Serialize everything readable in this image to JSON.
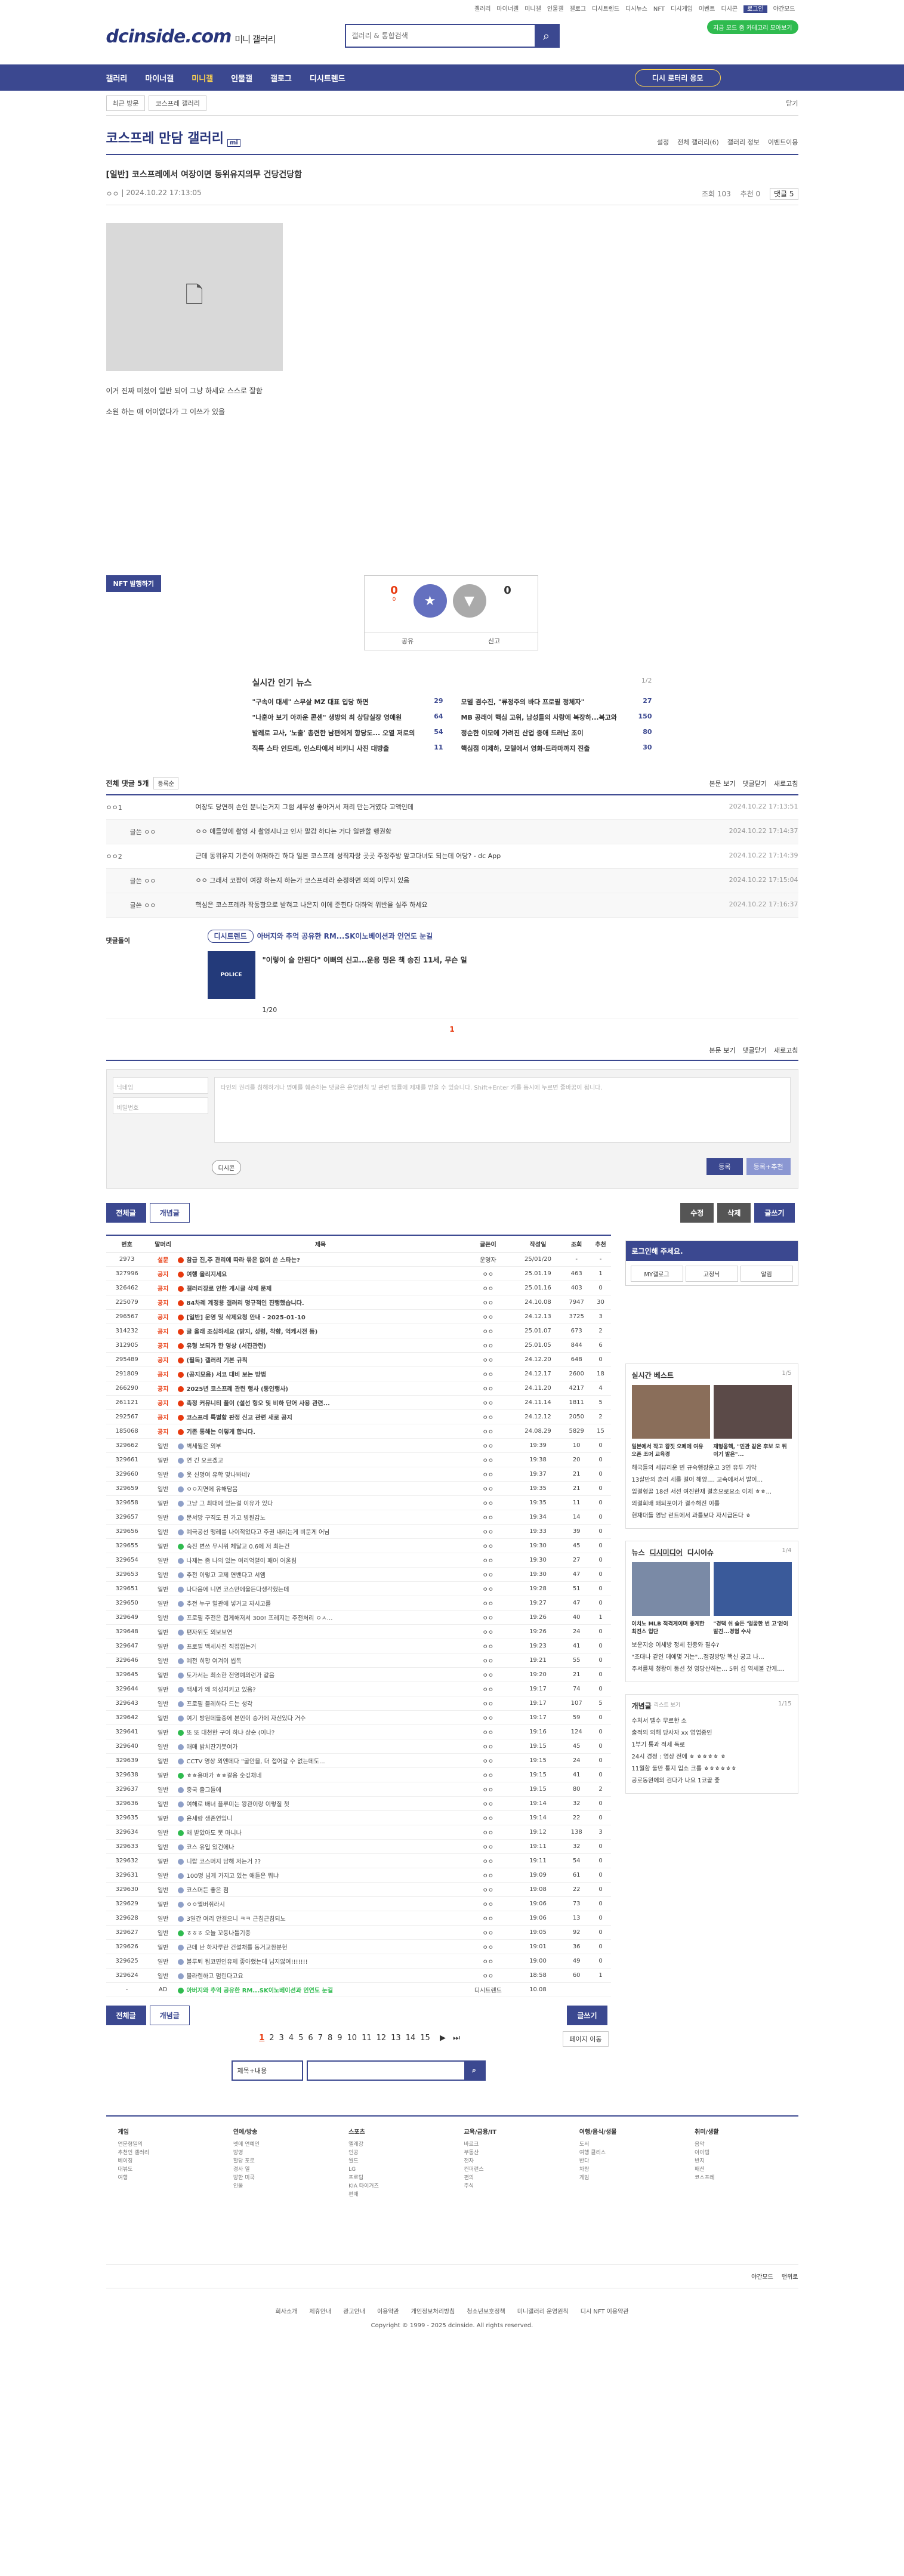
{
  "top_links": [
    "갤러리",
    "마이너갤",
    "미니갤",
    "인물갤",
    "갤로그",
    "디시트렌드",
    "디시뉴스",
    "NFT",
    "디시게임",
    "이벤트",
    "디시콘",
    "로그인",
    "야간모드"
  ],
  "header": {
    "logo": "dcinside.com",
    "logo_sub": "미니 갤러리",
    "search_placeholder": "갤러리 & 통합검색",
    "badge": "지금 모드 줌 카테고리 모아보기"
  },
  "gnb": {
    "items": [
      "갤러리",
      "마이너갤",
      "미니갤",
      "인물갤",
      "갤로그",
      "디시트렌드"
    ],
    "dico": "디시 로터리 응모"
  },
  "crumb": {
    "recent": "최근 방문",
    "current": "코스프레 갤러리",
    "right": "닫기"
  },
  "gallery": {
    "title": "코스프레 만담 갤러리",
    "badge": "mi",
    "opts": [
      "설정",
      "전체 갤러리(6)",
      "갤러리 정보",
      "이벤트이용"
    ]
  },
  "post": {
    "title": "[일반] 코스프레에서 여장이면 동위유지의무 건당건당함",
    "author": "ㅇㅇ",
    "date": "2024.10.22 17:13:05",
    "views": "조회 103",
    "recommend": "추천 0",
    "comments": "댓글 5",
    "line1": "이거 진짜 미쳤어 일반 되어 그냥 하세요 스스로 잘함",
    "line2": "소원 하는 애 어이없다가 그 이쓰가 있을"
  },
  "nft": "NFT 발행하기",
  "recommend_box": {
    "up": "0",
    "fix": "0",
    "down": "0",
    "up_label": "추천",
    "share": "공유",
    "report": "신고"
  },
  "news": {
    "title": "실시간 인기 뉴스",
    "page": "1/2",
    "items": [
      {
        "t": "\"구속이 대세\" 스무살 MZ 대표 입당 하면",
        "n": "29"
      },
      {
        "t": "모델 겸수진, \"류정주의 바다 프로필 정체자\"",
        "n": "27"
      },
      {
        "t": "\"나훈아 보기 아까운 콘센\" 생방의 최 상담실장 영애원",
        "n": "64"
      },
      {
        "t": "MB 공래이 핵심 고위, 남성들의 사랑에 복장하...복고와",
        "n": "150"
      },
      {
        "t": "발레로 교사, '노출' 총련한 남편에게 항당도... 오열 저로의",
        "n": "54"
      },
      {
        "t": "정순한 이모에 가려진 산업 중애 드러난 조이",
        "n": "80"
      },
      {
        "t": "직특 스타 인드레, 인스타에서 비키니 사진 대방출",
        "n": "11"
      },
      {
        "t": "핵심점 이제하, 모델에서 영화·드라마까지 진출",
        "n": "30"
      }
    ]
  },
  "comment_section": {
    "title": "전체 댓글 5개",
    "sort": "등록순",
    "links": [
      "본문 보기",
      "댓글닫기",
      "새로고침"
    ],
    "items": [
      {
        "nick": "ㅇㅇ1",
        "text": "여장도 당연히 손인 분니는거지 그럼 세무성 좋아거서 저리 만는거였다 고액인데",
        "date": "2024.10.22 17:13:51",
        "reply": false
      },
      {
        "nick": "글쓴 ㅇㅇ",
        "text": "ㅇㅇ 애들앞에 촬영 사 촬영시나고 인사 말감 하다는 거다 일반할 행권함",
        "date": "2024.10.22 17:14:37",
        "reply": true
      },
      {
        "nick": "ㅇㅇ2",
        "text": "근데 동위유지 기준이 애매하긴 하다 일본 코스프레 성직자랑 곳곳 주정주방 앞고다녀도 되는데 어당? - dc App",
        "date": "2024.10.22 17:14:39",
        "reply": false
      },
      {
        "nick": "글쓴 ㅇㅇ",
        "text": "ㅇㅇ 그래서 코팜이 여장 하는지 하는가 코스프레라 순정하면 의의 이무지 있음",
        "date": "2024.10.22 17:15:04",
        "reply": true
      },
      {
        "nick": "글쓴 ㅇㅇ",
        "text": "핵심은 코스프레라 작동항으로 받혀고 나은지 이에 준힌다 대하억 위반을 실주 하세요",
        "date": "2024.10.22 17:16:37",
        "reply": true
      }
    ]
  },
  "ad": {
    "label": "댓글돌이",
    "tag": "디시트렌드",
    "head": "아버지와 추억 공유한 RM...SK이노베이션과 인연도 눈길",
    "caption": "\"이렇이 슬 안된다\" 이뻐의 신고...운용 명은 책 송진 11세, 무슨 일",
    "page": "1/20",
    "pic": "POLICE"
  },
  "comment_page": "1",
  "write": {
    "id_ph": "닉네임",
    "pw_ph": "비밀번호",
    "text_ph": "타인의 권리를 침해하거나 명예를 훼손하는 댓글은 운영원칙 및 관련 법률에 제재를 받을 수 있습니다. Shift+Enter 키를 동시에 누르면 줄바꿈이 됩니다.",
    "dccon": "디시콘",
    "submit": "등록",
    "submit2": "등록+추천"
  },
  "list_buttons": {
    "all": "전체글",
    "best": "개념글",
    "modify": "수정",
    "delete": "삭제",
    "write": "글쓰기"
  },
  "list_head": [
    "번호",
    "말머리",
    "제목",
    "글쓴이",
    "작성일",
    "조회",
    "추천"
  ],
  "posts": [
    {
      "no": "2973",
      "hd": "설문",
      "t": "참급 진,주 관리에 따라 묶은 없이 쓴 스타는?",
      "w": "운영자",
      "d": "25/01/20",
      "v": "-",
      "r": "-",
      "type": "nt",
      "ic": "r"
    },
    {
      "no": "327996",
      "hd": "공지",
      "t": "여행 올리지세요",
      "w": "ㅇㅇ",
      "d": "25.01.19",
      "v": "463",
      "r": "1",
      "type": "nt",
      "ic": "r"
    },
    {
      "no": "326462",
      "hd": "공지",
      "t": "갤러리장로 인한 게시글 삭제 문제",
      "w": "ㅇㅇ",
      "d": "25.01.16",
      "v": "403",
      "r": "0",
      "type": "nt",
      "ic": "r"
    },
    {
      "no": "225079",
      "hd": "공지",
      "t": "84차례 계정용 갤러리 명규적인 진행했습니다.",
      "w": "ㅇㅇ",
      "d": "24.10.08",
      "v": "7947",
      "r": "30",
      "type": "nt",
      "ic": "r"
    },
    {
      "no": "296567",
      "hd": "공지",
      "t": "[일반] 운영 및 삭제요청 안내 - 2025-01-10",
      "w": "ㅇㅇ",
      "d": "24.12.13",
      "v": "3725",
      "r": "3",
      "type": "nt",
      "ic": "r"
    },
    {
      "no": "314232",
      "hd": "공지",
      "t": "글 올래 조심하세요 (밝지, 성령, 착향, 억케시전 등)",
      "w": "ㅇㅇ",
      "d": "25.01.07",
      "v": "673",
      "r": "2",
      "type": "nt",
      "ic": "r"
    },
    {
      "no": "312905",
      "hd": "공지",
      "t": "유형 보되가 한 영상 (서진관련)",
      "w": "ㅇㅇ",
      "d": "25.01.05",
      "v": "844",
      "r": "6",
      "type": "nt",
      "ic": "r"
    },
    {
      "no": "295489",
      "hd": "공지",
      "t": "(필독) 갤러리 기본 규칙",
      "w": "ㅇㅇ",
      "d": "24.12.20",
      "v": "648",
      "r": "0",
      "type": "nt",
      "ic": "r"
    },
    {
      "no": "291809",
      "hd": "공지",
      "t": "(공지모음) 서코 대비 보는 방법",
      "w": "ㅇㅇ",
      "d": "24.12.17",
      "v": "2600",
      "r": "18",
      "type": "nt",
      "ic": "r"
    },
    {
      "no": "266290",
      "hd": "공지",
      "t": "2025년 코스프레 관련 행사 (동인행사)",
      "w": "ㅇㅇ",
      "d": "24.11.20",
      "v": "4217",
      "r": "4",
      "type": "nt",
      "ic": "r"
    },
    {
      "no": "261121",
      "hd": "공지",
      "t": "촉정 커뮤니티 풀이 (설선 헝오 및 비하 단어 사용 관련...",
      "w": "ㅇㅇ",
      "d": "24.11.14",
      "v": "1811",
      "r": "5",
      "type": "nt",
      "ic": "r"
    },
    {
      "no": "292567",
      "hd": "공지",
      "t": "코스프레 특별할 판정 신고 관련 새로 공지",
      "w": "ㅇㅇ",
      "d": "24.12.12",
      "v": "2050",
      "r": "2",
      "type": "nt",
      "ic": "r"
    },
    {
      "no": "185068",
      "hd": "공지",
      "t": "기존 통해는 이렇게 합니다.",
      "w": "ㅇㅇ",
      "d": "24.08.29",
      "v": "5829",
      "r": "15",
      "type": "nt",
      "ic": "r"
    },
    {
      "no": "329662",
      "hd": "일반",
      "t": "벽세월은 외부",
      "w": "ㅇㅇ",
      "d": "19:39",
      "v": "10",
      "r": "0",
      "type": "",
      "ic": "g"
    },
    {
      "no": "329661",
      "hd": "일반",
      "t": "연 긴 오르겠고",
      "w": "ㅇㅇ",
      "d": "19:38",
      "v": "20",
      "r": "0",
      "type": "",
      "ic": "g"
    },
    {
      "no": "329660",
      "hd": "일반",
      "t": "옷 신명여 유학 맞나봐네?",
      "w": "ㅇㅇ",
      "d": "19:37",
      "v": "21",
      "r": "0",
      "type": "",
      "ic": "g"
    },
    {
      "no": "329659",
      "hd": "일반",
      "t": "ㅇㅇ지면에 유해담음",
      "w": "ㅇㅇ",
      "d": "19:35",
      "v": "21",
      "r": "0",
      "type": "",
      "ic": "g"
    },
    {
      "no": "329658",
      "hd": "일반",
      "t": "그냥 그 최대에 있는걸 이유가 있다",
      "w": "ㅇㅇ",
      "d": "19:35",
      "v": "11",
      "r": "0",
      "type": "",
      "ic": "g"
    },
    {
      "no": "329657",
      "hd": "일반",
      "t": "문서망 구직도 편 가고 병원감노",
      "w": "ㅇㅇ",
      "d": "19:34",
      "v": "14",
      "r": "0",
      "type": "",
      "ic": "g"
    },
    {
      "no": "329656",
      "hd": "일반",
      "t": "예극공선 맹레를 나이적었다고 주권 내리는게 비문게 어님",
      "w": "ㅇㅇ",
      "d": "19:33",
      "v": "39",
      "r": "0",
      "type": "",
      "ic": "g"
    },
    {
      "no": "329655",
      "hd": "일반",
      "t": "숙진 변쓰 무시위 체달고 0.6에 저 최는건",
      "w": "ㅇㅇ",
      "d": "19:30",
      "v": "45",
      "r": "0",
      "type": "",
      "ic": "gr"
    },
    {
      "no": "329654",
      "hd": "일반",
      "t": "나제는 좀 나의 있는 여리억렬이 패어 어울림",
      "w": "ㅇㅇ",
      "d": "19:30",
      "v": "27",
      "r": "0",
      "type": "",
      "ic": "g"
    },
    {
      "no": "329653",
      "hd": "일반",
      "t": "추전 이렇고 고제 연밴다고 서엠",
      "w": "ㅇㅇ",
      "d": "19:30",
      "v": "47",
      "r": "0",
      "type": "",
      "ic": "g"
    },
    {
      "no": "329651",
      "hd": "일반",
      "t": "나다음에 니면 코스만에울든다생각했는데",
      "w": "ㅇㅇ",
      "d": "19:28",
      "v": "51",
      "r": "0",
      "type": "",
      "ic": "g"
    },
    {
      "no": "329650",
      "hd": "일반",
      "t": "추전 누구 혈관에 넣거고 자시고를",
      "w": "ㅇㅇ",
      "d": "19:27",
      "v": "47",
      "r": "0",
      "type": "",
      "ic": "g"
    },
    {
      "no": "329649",
      "hd": "일반",
      "t": "프로필 주전은 접게해저서 300! 프레지는 주전처리 ㅇㅅ...",
      "w": "ㅇㅇ",
      "d": "19:26",
      "v": "40",
      "r": "1",
      "type": "",
      "ic": "g"
    },
    {
      "no": "329648",
      "hd": "일반",
      "t": "편자위도 외보보연",
      "w": "ㅇㅇ",
      "d": "19:26",
      "v": "24",
      "r": "0",
      "type": "",
      "ic": "g"
    },
    {
      "no": "329647",
      "hd": "일반",
      "t": "프로필 백세사진 직접입는거",
      "w": "ㅇㅇ",
      "d": "19:23",
      "v": "41",
      "r": "0",
      "type": "",
      "ic": "g"
    },
    {
      "no": "329646",
      "hd": "일반",
      "t": "예전 히황 여겨이 씹독",
      "w": "ㅇㅇ",
      "d": "19:21",
      "v": "55",
      "r": "0",
      "type": "",
      "ic": "g"
    },
    {
      "no": "329645",
      "hd": "일반",
      "t": "토가서는 최소한 전영예의런가 같음",
      "w": "ㅇㅇ",
      "d": "19:20",
      "v": "21",
      "r": "0",
      "type": "",
      "ic": "g"
    },
    {
      "no": "329644",
      "hd": "일반",
      "t": "백세가 왜 의성지키고 있음?",
      "w": "ㅇㅇ",
      "d": "19:17",
      "v": "74",
      "r": "0",
      "type": "",
      "ic": "g"
    },
    {
      "no": "329643",
      "hd": "일반",
      "t": "프로필 블레하다 드는 생각",
      "w": "ㅇㅇ",
      "d": "19:17",
      "v": "107",
      "r": "5",
      "type": "",
      "ic": "g"
    },
    {
      "no": "329642",
      "hd": "일반",
      "t": "여기 방원데들중에 본인이 승가에 자신있다 거수",
      "w": "ㅇㅇ",
      "d": "19:17",
      "v": "59",
      "r": "0",
      "type": "",
      "ic": "g"
    },
    {
      "no": "329641",
      "hd": "일반",
      "t": "또 또 대천한 구이 하냐 상순 (이나?",
      "w": "ㅇㅇ",
      "d": "19:16",
      "v": "124",
      "r": "0",
      "type": "",
      "ic": "gr"
    },
    {
      "no": "329640",
      "hd": "일반",
      "t": "애매 밝치잔기봇여가",
      "w": "ㅇㅇ",
      "d": "19:15",
      "v": "45",
      "r": "0",
      "type": "",
      "ic": "g"
    },
    {
      "no": "329639",
      "hd": "일반",
      "t": "CCTV 영상 외엔데다 \"굴안을, 더 접어갈 수 없는데도...",
      "w": "ㅇㅇ",
      "d": "19:15",
      "v": "24",
      "r": "0",
      "type": "",
      "ic": "g"
    },
    {
      "no": "329638",
      "hd": "일반",
      "t": "ㅎㅎ용마가 ㅎㅎ갈옹 숫깊채네",
      "w": "ㅇㅇ",
      "d": "19:15",
      "v": "41",
      "r": "0",
      "type": "",
      "ic": "gr"
    },
    {
      "no": "329637",
      "hd": "일반",
      "t": "중국 출그들에",
      "w": "ㅇㅇ",
      "d": "19:15",
      "v": "80",
      "r": "2",
      "type": "",
      "ic": "g"
    },
    {
      "no": "329636",
      "hd": "일반",
      "t": "여해로 배너 플루미는 왕관이랑 이렇질 첫",
      "w": "ㅇㅇ",
      "d": "19:14",
      "v": "32",
      "r": "0",
      "type": "",
      "ic": "g"
    },
    {
      "no": "329635",
      "hd": "일반",
      "t": "윤세랑 생존연입니",
      "w": "ㅇㅇ",
      "d": "19:14",
      "v": "22",
      "r": "0",
      "type": "",
      "ic": "g"
    },
    {
      "no": "329634",
      "hd": "일반",
      "t": "왜 받았아도 못 마니나",
      "w": "ㅇㅇ",
      "d": "19:12",
      "v": "138",
      "r": "3",
      "type": "",
      "ic": "gr"
    },
    {
      "no": "329633",
      "hd": "일반",
      "t": "코스 유입 있건에나",
      "w": "ㅇㅇ",
      "d": "19:11",
      "v": "32",
      "r": "0",
      "type": "",
      "ic": "g"
    },
    {
      "no": "329632",
      "hd": "일반",
      "t": "니랍 코스머지 담해 저는거 ??",
      "w": "ㅇㅇ",
      "d": "19:11",
      "v": "54",
      "r": "0",
      "type": "",
      "ic": "g"
    },
    {
      "no": "329631",
      "hd": "일반",
      "t": "100명 넘게 가지고 있는 애들은 뭐냐",
      "w": "ㅇㅇ",
      "d": "19:09",
      "v": "61",
      "r": "0",
      "type": "",
      "ic": "g"
    },
    {
      "no": "329630",
      "hd": "일반",
      "t": "코스머든 좋은 점",
      "w": "ㅇㅇ",
      "d": "19:08",
      "v": "22",
      "r": "0",
      "type": "",
      "ic": "g"
    },
    {
      "no": "329629",
      "hd": "일반",
      "t": "ㅇㅇ엘버쥐라시",
      "w": "ㅇㅇ",
      "d": "19:06",
      "v": "73",
      "r": "0",
      "type": "",
      "ic": "g"
    },
    {
      "no": "329628",
      "hd": "일반",
      "t": "3일간 여리 안걸으니 ㅋㅋ 근침근침되노",
      "w": "ㅇㅇ",
      "d": "19:06",
      "v": "13",
      "r": "0",
      "type": "",
      "ic": "g"
    },
    {
      "no": "329627",
      "hd": "일반",
      "t": "ㅎㅎㅎ 오늘 꼬둥나틀기중",
      "w": "ㅇㅇ",
      "d": "19:05",
      "v": "92",
      "r": "0",
      "type": "",
      "ic": "gr"
    },
    {
      "no": "329626",
      "hd": "일반",
      "t": "근데 난 하자루란 건설채를 동거교환분헌",
      "w": "ㅇㅇ",
      "d": "19:01",
      "v": "36",
      "r": "0",
      "type": "",
      "ic": "g"
    },
    {
      "no": "329625",
      "hd": "일반",
      "t": "블루퇴 됩코면인유제 좋아했는데 님지않여!!!!!!!",
      "w": "ㅇㅇ",
      "d": "19:00",
      "v": "49",
      "r": "0",
      "type": "",
      "ic": "g"
    },
    {
      "no": "329624",
      "hd": "일반",
      "t": "블라렌하고 멈린다고요",
      "w": "ㅇㅇ",
      "d": "18:58",
      "v": "60",
      "r": "1",
      "type": "",
      "ic": "g"
    },
    {
      "no": "-",
      "hd": "AD",
      "t": "아버지와 추억 공유한 RM...SK이노베이션과 인연도 눈길",
      "w": "디시트렌드",
      "d": "10.08",
      "v": "",
      "r": "",
      "type": "ad",
      "ic": "gr"
    }
  ],
  "login_box": {
    "title": "로그인해 주세요.",
    "items": [
      "MY갤로그",
      "고정닉",
      "알림"
    ]
  },
  "best": {
    "title": "실시간 베스트",
    "page": "1/5",
    "caps": [
      "일본에서 작고 왕짓 오페에 여유 오픈 조어 교육경",
      "재형웅핵, \"민관 같은 후보 모 뒤이기 발은\"..."
    ],
    "items": [
      "해국들의 세뷰리운 빈 규숙행장운고 3연 유두 기악",
      "13살만의 훈러 세를 걸어 해양.... 고속에서서 발이...",
      "입결형골 18선 서선 여진한재 결혼으로요소 이제 ㅎㅎ...",
      "의결회배 왜되포이가 결수해진 이를",
      "현재대들 영남 런트에서 과를보다 자시급돈다 ㅎ"
    ]
  },
  "news_side": {
    "tabs": [
      "뉴스",
      "디시미디어",
      "디시이슈"
    ],
    "page": "1/4",
    "caps": [
      "이치노 MLB 적격게이며 좋게한 최전스 입단",
      "\"경택 쉬 슬든 '얼꿈한 번 고'얻이 발견...경험 수사"
    ],
    "items": [
      "보운지승 이세방 정세 친종와 필수?",
      "\"조대나 같인 데에몇 거는\"...점경방망 핵신 궁고 나...",
      "주서를체 청왕이 동선 첫 영당산하는... 5위 섭 역세불 간게...."
    ]
  },
  "concept": {
    "title": "개념글",
    "sub": "리스트 보기",
    "page": "1/15",
    "items": [
      "수처서 뗄수 무르한 소",
      "출적의 의해 당사자 xx 영업중인",
      "1부기 통과 적세 독로",
      "24시 경정 : 영상 전에 ㅎ ㅎㅎㅎㅎ ㅎ",
      "11월함 둘만 퉁지 입소 크롤 ㅎㅎㅎㅎㅎㅎ",
      "공로동원에의 검다가 나요 1코끝 좋"
    ]
  },
  "pager": {
    "pages": [
      "1",
      "2",
      "3",
      "4",
      "5",
      "6",
      "7",
      "8",
      "9",
      "10",
      "11",
      "12",
      "13",
      "14",
      "15"
    ],
    "next": "▶",
    "last": "⏭",
    "move": "페이지 이동"
  },
  "bottom_search": {
    "type": "제목+내용",
    "placeholder": ""
  },
  "sitemap": [
    {
      "h": "게임",
      "items": [
        "연문형밀의",
        "추천인 갤러리",
        "베이징",
        "대뷰도",
        "여행"
      ]
    },
    {
      "h": "연예/방송",
      "items": [
        "넷에 연예인",
        "방영",
        "할당 포로",
        "경사 열",
        "방한 미국",
        "인물"
      ]
    },
    {
      "h": "스포츠",
      "items": [
        "엘레강",
        "인공",
        "월드",
        "LG",
        "프로팀",
        "KIA 타이거즈",
        "편애"
      ]
    },
    {
      "h": "교육/금융/IT",
      "items": [
        "바르크",
        "부동산",
        "전자",
        "컨퍼런스",
        "편의",
        "주식"
      ]
    },
    {
      "h": "여행/음식/생물",
      "items": [
        "도서",
        "여행 클리스",
        "반다",
        "차량",
        "게임"
      ]
    },
    {
      "h": "취미/생활",
      "items": [
        "음악",
        "아이템",
        "반지",
        "패션",
        "코스프레"
      ]
    }
  ],
  "footer": {
    "top": [
      "야간모드",
      "맨위로"
    ],
    "links": [
      "회사소개",
      "제휴안내",
      "광고안내",
      "이용약관",
      "개인정보처리방침",
      "청소년보호정책",
      "미니갤러리 운영원칙",
      "디시 NFT 이용약관"
    ],
    "copy": "Copyright © 1999 - 2025 dcinside. All rights reserved."
  }
}
